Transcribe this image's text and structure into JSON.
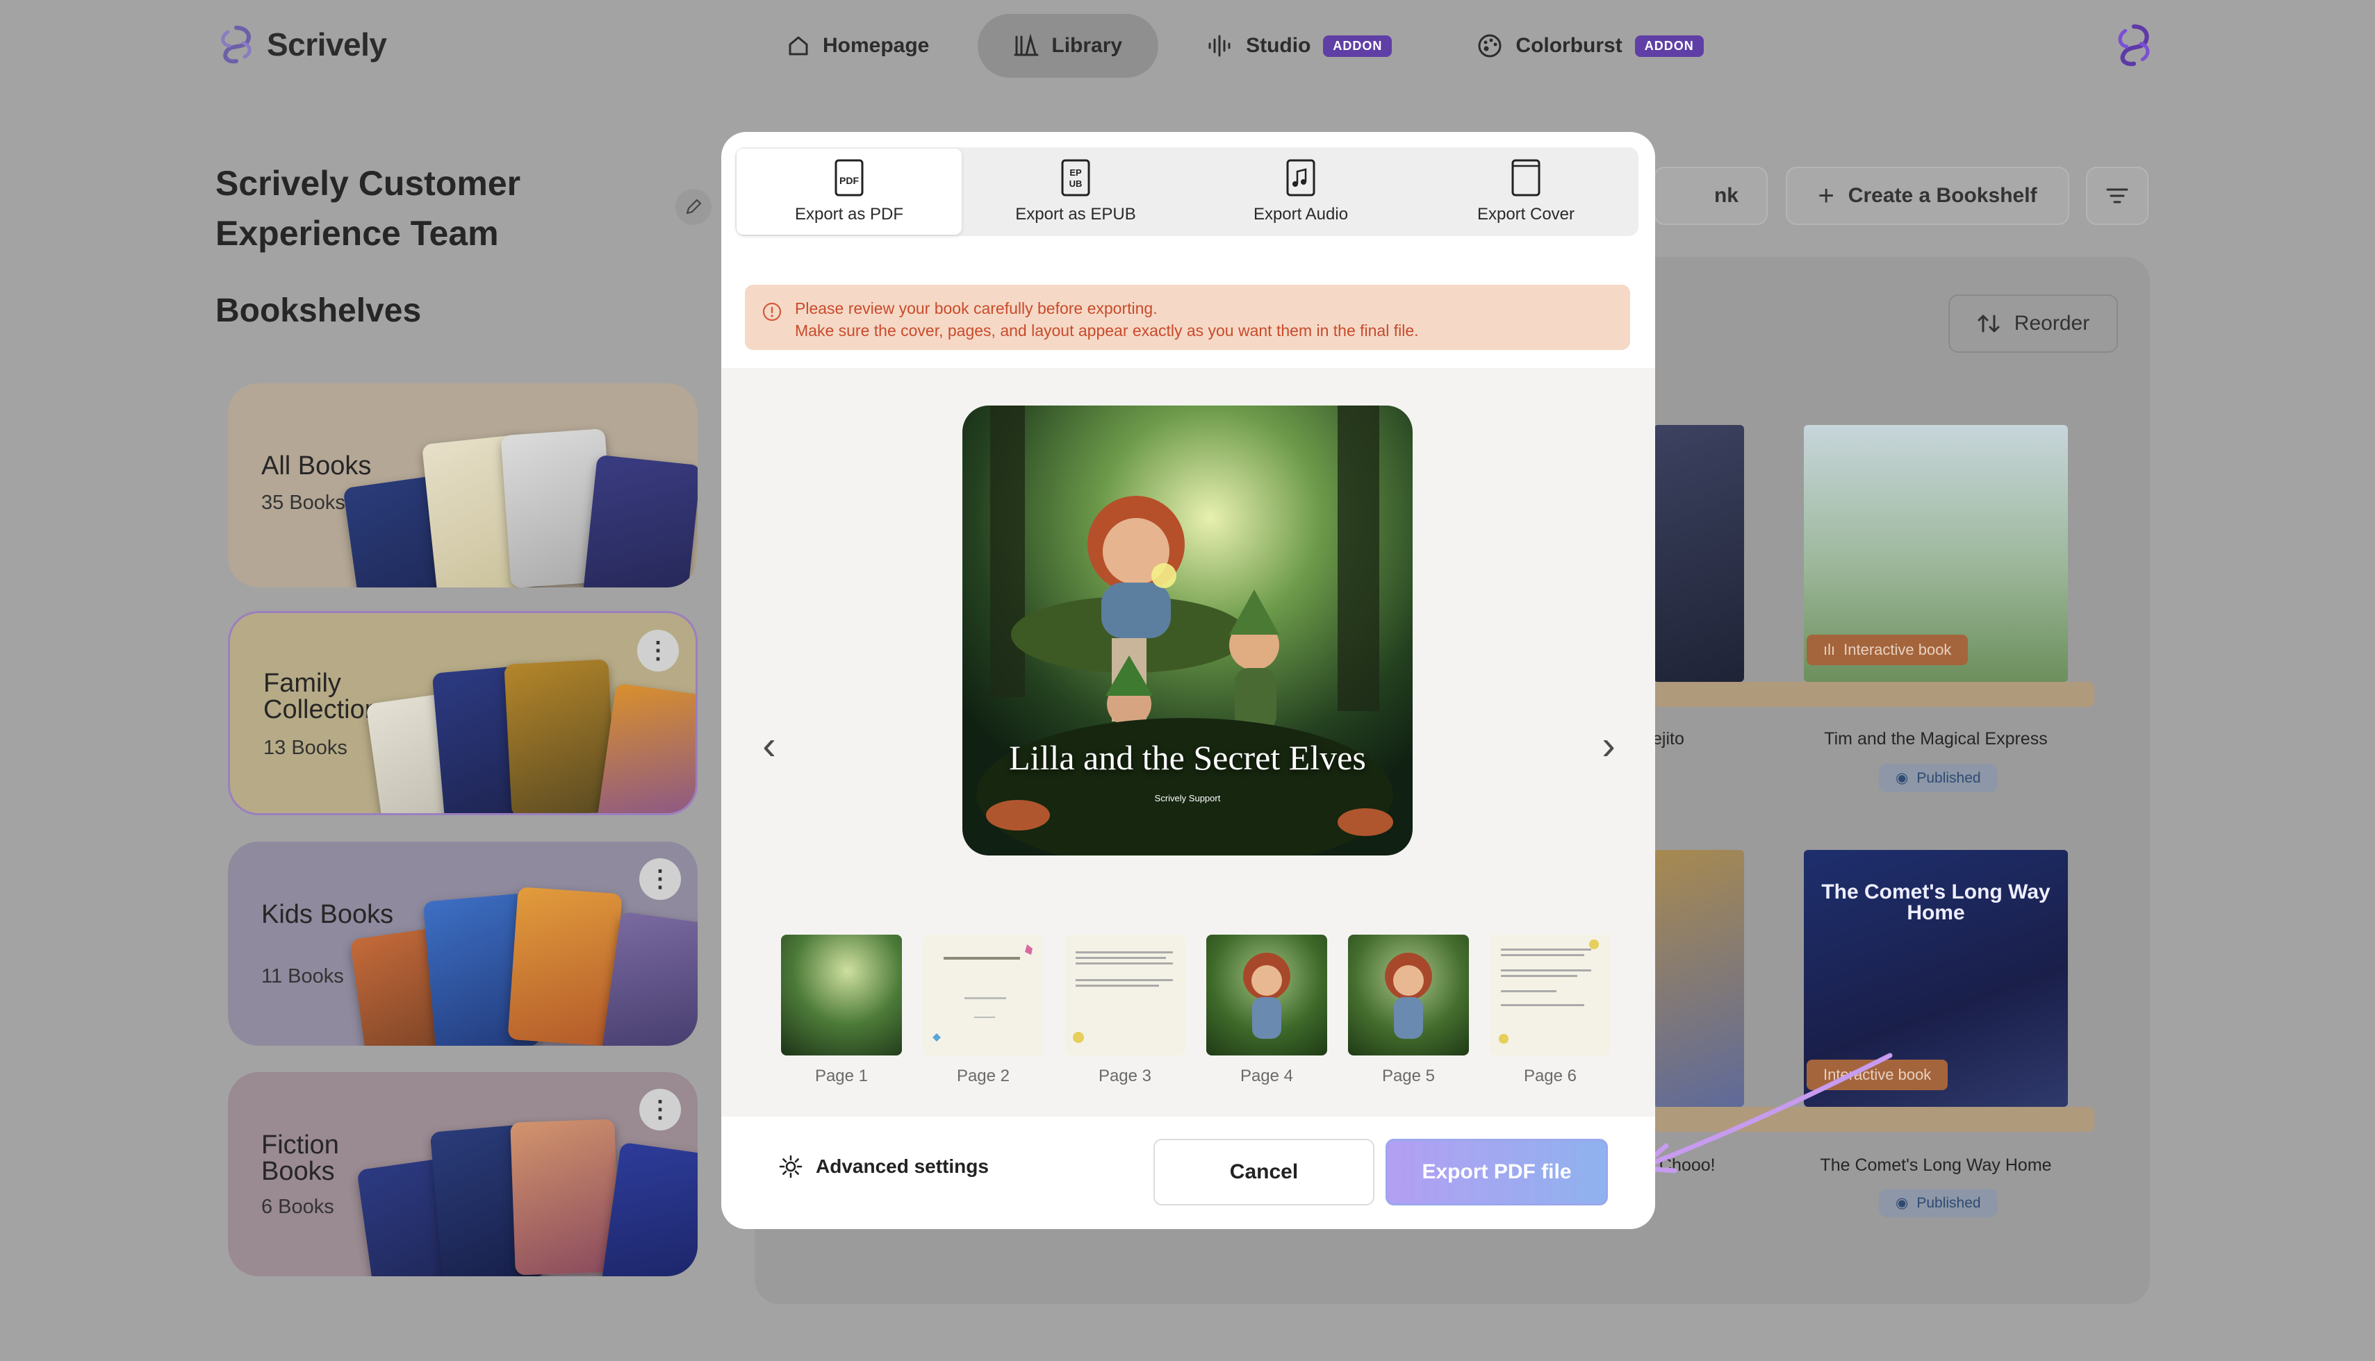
{
  "app": {
    "name": "Scrively",
    "accent": "#7b4fd6",
    "addon_color": "#5f3fa6"
  },
  "nav": {
    "items": [
      {
        "label": "Homepage",
        "icon": "home-icon"
      },
      {
        "label": "Library",
        "icon": "library-icon",
        "active": true
      },
      {
        "label": "Studio",
        "icon": "audio-waveform-icon",
        "badge": "ADDON"
      },
      {
        "label": "Colorburst",
        "icon": "palette-icon",
        "badge": "ADDON"
      }
    ]
  },
  "sidebar": {
    "team_name": "Scrively Customer Experience Team",
    "section_title": "Bookshelves",
    "shelves": [
      {
        "name": "All Books",
        "count": "35 Books",
        "color": "#b4a796"
      },
      {
        "name": "Family Collection",
        "count": "13 Books",
        "color": "#b7ab87"
      },
      {
        "name": "Kids Books",
        "count": "11 Books",
        "color": "#8f8a9e"
      },
      {
        "name": "Fiction Books",
        "count": "6 Books",
        "color": "#9a8a92"
      }
    ]
  },
  "background": {
    "link_btn_partial": "nk",
    "create_bookshelf": "Create a Bookshelf",
    "reorder": "Reorder",
    "books": [
      {
        "title_partial": "ejito"
      },
      {
        "title": "Tim and the Magical Express",
        "tag": "Interactive book",
        "status": "Published"
      },
      {
        "title_partial": "Chooo!"
      },
      {
        "title": "The Comet's Long Way Home",
        "tag": "Interactive book",
        "status": "Published",
        "cover_text": "The Comet's Long Way Home"
      }
    ]
  },
  "modal": {
    "tabs": [
      {
        "label": "Export as PDF",
        "icon": "pdf-file-icon",
        "active": true
      },
      {
        "label": "Export as EPUB",
        "icon": "epub-file-icon"
      },
      {
        "label": "Export Audio",
        "icon": "audio-file-icon"
      },
      {
        "label": "Export Cover",
        "icon": "cover-page-icon"
      }
    ],
    "warning_line1": "Please review your book carefully before exporting.",
    "warning_line2": "Make sure the cover, pages, and layout appear exactly as you want them in the final file.",
    "cover_title": "Lilla and the Secret Elves",
    "cover_author": "Scrively Support",
    "pages": [
      "Page 1",
      "Page 2",
      "Page 3",
      "Page 4",
      "Page 5",
      "Page 6"
    ],
    "advanced_settings": "Advanced settings",
    "cancel": "Cancel",
    "export": "Export PDF file"
  }
}
